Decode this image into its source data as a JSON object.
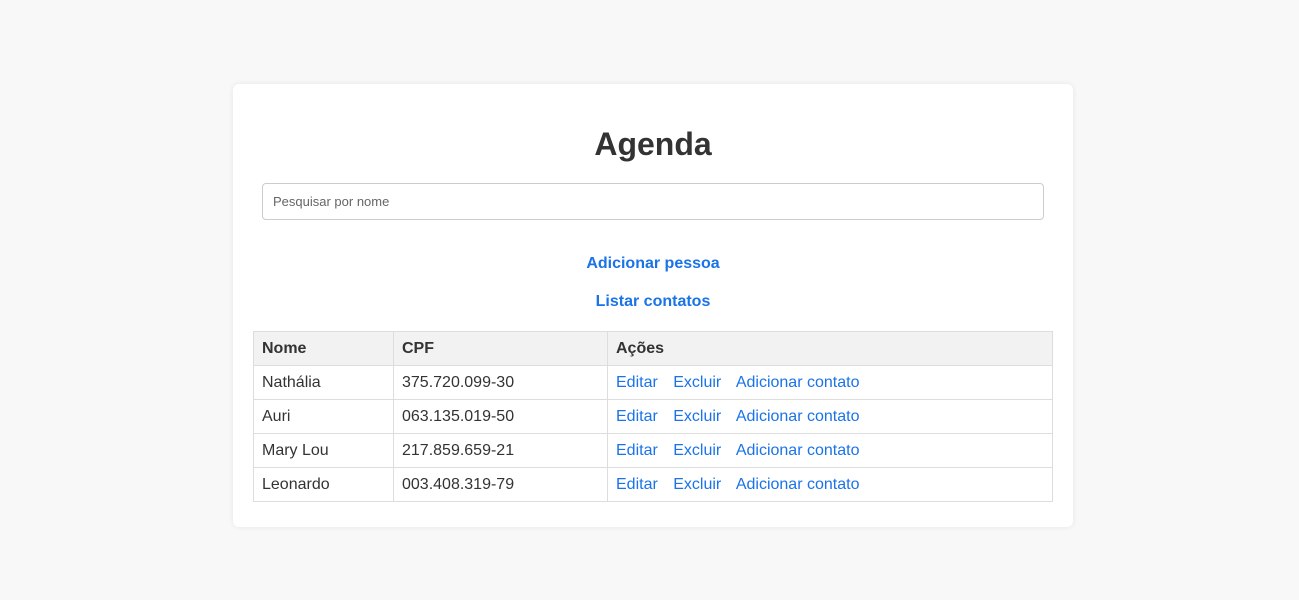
{
  "page": {
    "title": "Agenda"
  },
  "search": {
    "placeholder": "Pesquisar por nome",
    "value": ""
  },
  "nav": {
    "add_person": "Adicionar pessoa",
    "list_contacts": "Listar contatos"
  },
  "table": {
    "headers": [
      "Nome",
      "CPF",
      "Ações"
    ],
    "rows": [
      {
        "nome": "Nathália",
        "cpf": "375.720.099-30"
      },
      {
        "nome": "Auri",
        "cpf": "063.135.019-50"
      },
      {
        "nome": "Mary Lou",
        "cpf": "217.859.659-21"
      },
      {
        "nome": "Leonardo",
        "cpf": "003.408.319-79"
      }
    ],
    "actions": {
      "edit": "Editar",
      "delete": "Excluir",
      "add_contact": "Adicionar contato"
    }
  },
  "colors": {
    "link": "#1a73e8",
    "background": "#f8f8f8",
    "card": "#ffffff",
    "header_bg": "#f2f2f2"
  }
}
